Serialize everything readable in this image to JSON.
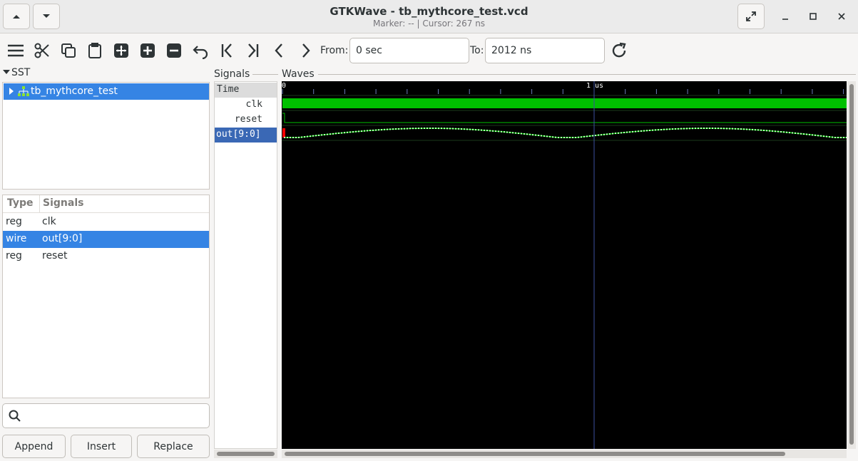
{
  "window": {
    "title": "GTKWave - tb_mythcore_test.vcd",
    "subtitle": "Marker: --  |  Cursor: 267 ns"
  },
  "toolbar": {
    "from_label": "From:",
    "from_value": "0 sec",
    "to_label": "To:",
    "to_value": "2012 ns",
    "icons": [
      "menu-icon",
      "cut-icon",
      "copy-icon",
      "paste-icon",
      "zoom-fit-icon",
      "zoom-in-icon",
      "zoom-out-icon",
      "undo-icon",
      "jump-start-icon",
      "jump-end-icon",
      "prev-edge-icon",
      "next-edge-icon",
      "reload-icon"
    ]
  },
  "sst": {
    "header": "SST",
    "tree_item": "tb_mythcore_test"
  },
  "signal_list": {
    "col_type": "Type",
    "col_signals": "Signals",
    "rows": [
      {
        "type": "reg",
        "name": "clk",
        "selected": false
      },
      {
        "type": "wire",
        "name": "out[9:0]",
        "selected": true
      },
      {
        "type": "reg",
        "name": "reset",
        "selected": false
      }
    ]
  },
  "search": {
    "placeholder": ""
  },
  "buttons": {
    "append": "Append",
    "insert": "Insert",
    "replace": "Replace"
  },
  "signals_pane": {
    "label": "Signals",
    "time_label": "Time",
    "names": [
      "clk",
      "reset",
      "out[9:0]"
    ]
  },
  "waves_pane": {
    "label": "Waves",
    "ruler_start": "0",
    "ruler_1us": "1 us",
    "cursor_time_ns": 1000,
    "range_ns": 1806
  },
  "colors": {
    "accent": "#3584e4",
    "wave_green": "#00c000",
    "wave_bg": "#000000",
    "marker_red": "#ff0000",
    "selected_signal": "#3a68b5"
  }
}
